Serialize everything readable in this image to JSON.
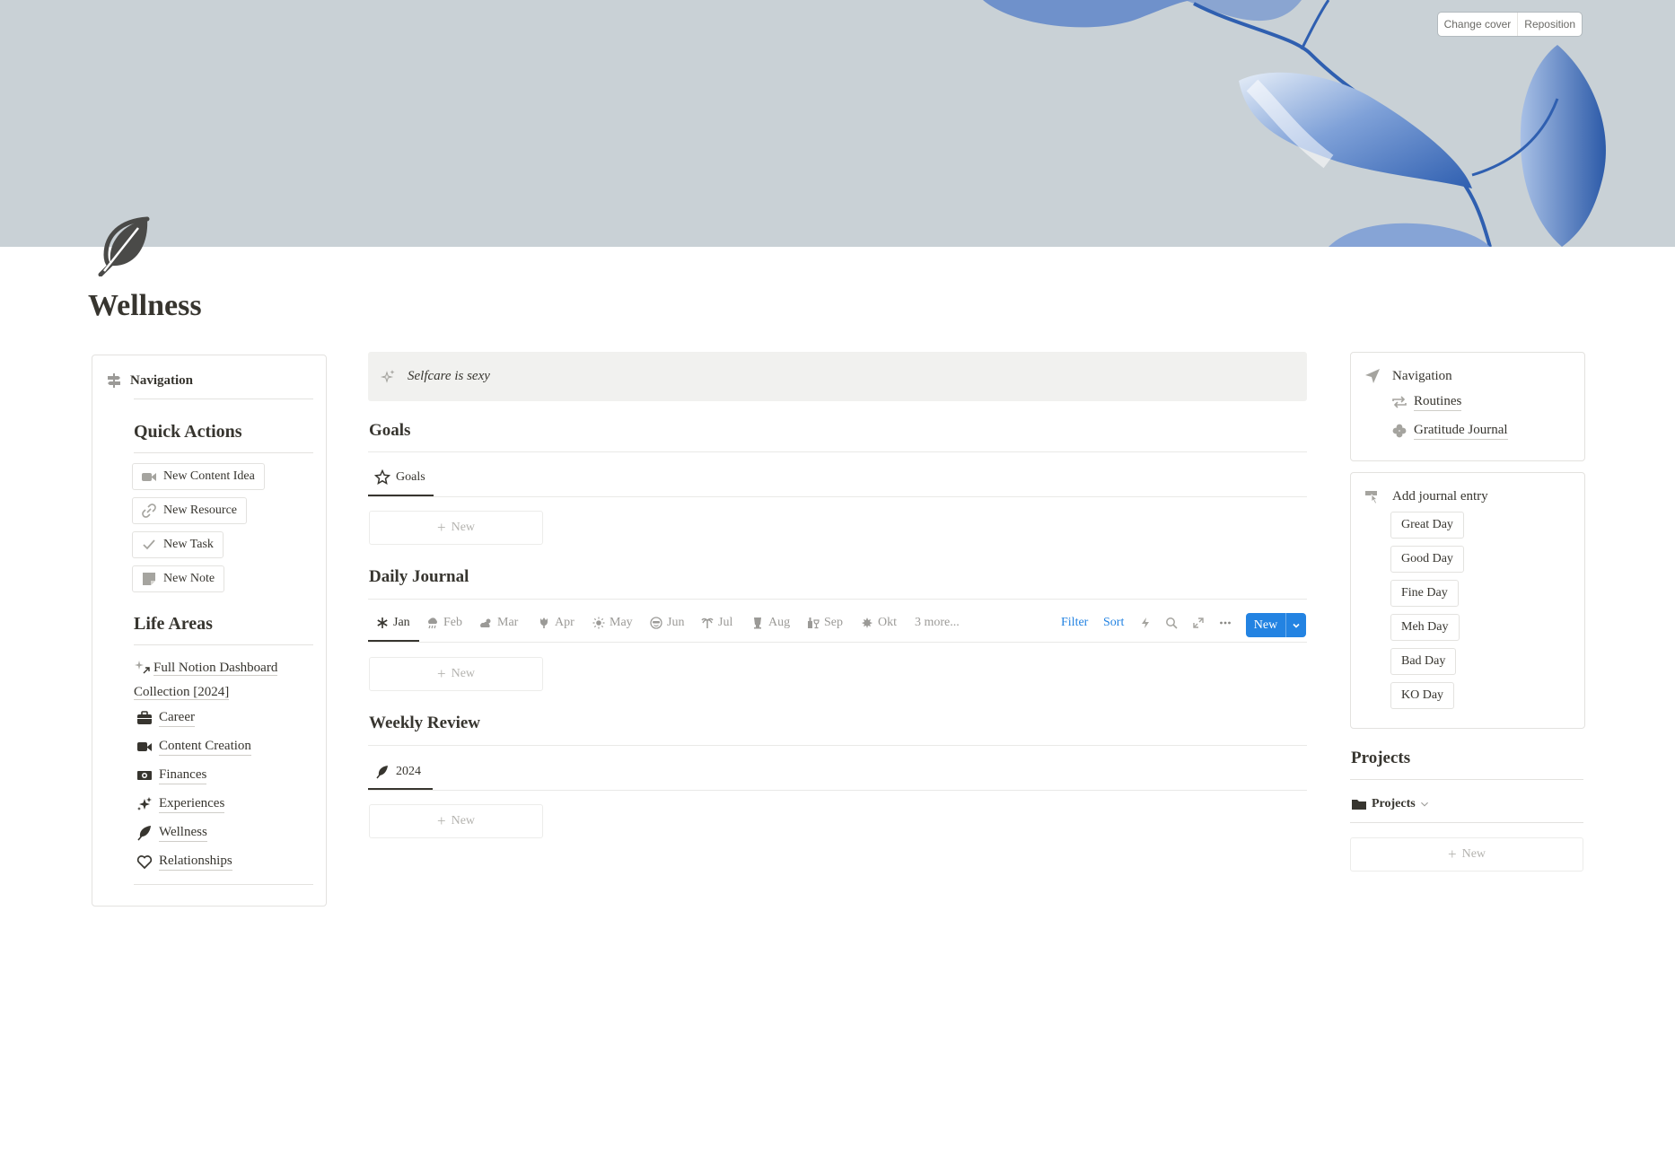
{
  "cover": {
    "change_cover": "Change cover",
    "reposition": "Reposition"
  },
  "page": {
    "title": "Wellness",
    "icon": "leaf-icon"
  },
  "left_panel": {
    "navigation_label": "Navigation",
    "quick_actions_title": "Quick Actions",
    "quick_actions": [
      {
        "label": "New Content Idea",
        "icon": "video-camera-icon"
      },
      {
        "label": "New Resource",
        "icon": "link-icon"
      },
      {
        "label": "New Task",
        "icon": "checkmark-icon"
      },
      {
        "label": "New Note",
        "icon": "sticky-note-icon"
      }
    ],
    "life_areas_title": "Life Areas",
    "life_areas": [
      {
        "label_line1": "Full Notion Dashboard",
        "label_line2": "Collection [2024]",
        "icon": "sparkle-link-icon"
      },
      {
        "label": "Career",
        "icon": "briefcase-icon"
      },
      {
        "label": "Content Creation",
        "icon": "video-camera-icon"
      },
      {
        "label": "Finances",
        "icon": "money-icon"
      },
      {
        "label": "Experiences",
        "icon": "sparkles-icon"
      },
      {
        "label": "Wellness",
        "icon": "leaf-icon"
      },
      {
        "label": "Relationships",
        "icon": "heart-icon"
      }
    ]
  },
  "callout": {
    "text": "Selfcare is sexy",
    "icon": "sparkles-icon"
  },
  "goals": {
    "title": "Goals",
    "tab": "Goals",
    "new_label": "New"
  },
  "daily_journal": {
    "title": "Daily Journal",
    "months": [
      {
        "label": "Jan",
        "icon": "snowflake-icon"
      },
      {
        "label": "Feb",
        "icon": "cloud-rain-icon"
      },
      {
        "label": "Mar",
        "icon": "sun-cloud-icon"
      },
      {
        "label": "Apr",
        "icon": "tulip-icon"
      },
      {
        "label": "May",
        "icon": "sun-icon"
      },
      {
        "label": "Jun",
        "icon": "sunglasses-face-icon"
      },
      {
        "label": "Jul",
        "icon": "palm-tree-icon"
      },
      {
        "label": "Aug",
        "icon": "drink-icon"
      },
      {
        "label": "Sep",
        "icon": "wine-bottles-icon"
      },
      {
        "label": "Okt",
        "icon": "maple-leaf-icon"
      }
    ],
    "more_label": "3 more...",
    "filter_label": "Filter",
    "sort_label": "Sort",
    "new_button": "New",
    "new_label": "New"
  },
  "weekly_review": {
    "title": "Weekly Review",
    "tab": "2024",
    "new_label": "New"
  },
  "right_nav": {
    "title": "Navigation",
    "items": [
      {
        "label": "Routines",
        "icon": "repeat-icon"
      },
      {
        "label": "Gratitude Journal",
        "icon": "clover-icon"
      }
    ]
  },
  "journal_entry": {
    "title": "Add journal entry",
    "buttons": [
      "Great Day",
      "Good Day",
      "Fine Day",
      "Meh Day",
      "Bad Day",
      "KO Day"
    ]
  },
  "projects": {
    "title": "Projects",
    "view_label": "Projects",
    "new_label": "New"
  },
  "colors": {
    "accent": "#2383e2",
    "cover_bg": "#c9d1d6",
    "leaf_blue": "#3f6cb8",
    "text": "#37352f",
    "muted": "#9b9a97"
  }
}
